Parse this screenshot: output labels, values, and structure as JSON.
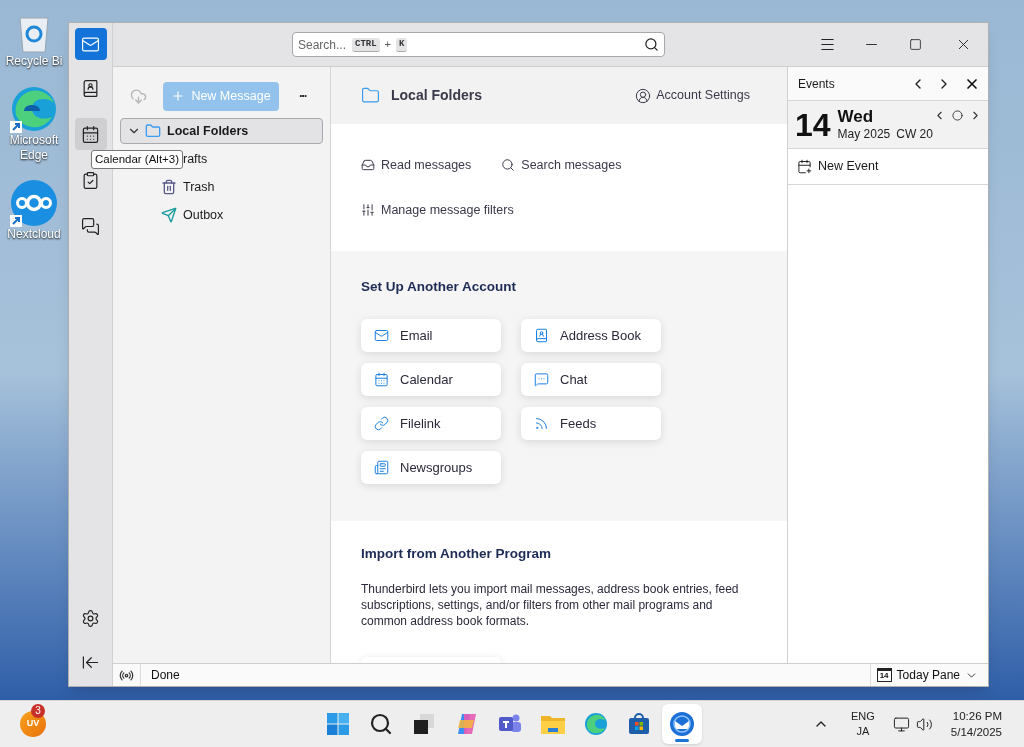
{
  "desktop_icons": [
    {
      "kind": "recycle",
      "label": "Recycle Bi"
    },
    {
      "kind": "edge",
      "label": "Microsoft Edge"
    },
    {
      "kind": "nextcloud",
      "label": "Nextcloud"
    }
  ],
  "search": {
    "placeholder": "Search...",
    "keys": [
      "CTRL",
      "K"
    ],
    "joiner": "+"
  },
  "spaces": [
    {
      "kind": "mail",
      "selected": true,
      "hovered": false
    },
    {
      "kind": "address",
      "selected": false,
      "hovered": false
    },
    {
      "kind": "calendar",
      "selected": false,
      "hovered": true
    },
    {
      "kind": "tasks",
      "selected": false,
      "hovered": false
    },
    {
      "kind": "chat",
      "selected": false,
      "hovered": false
    }
  ],
  "spaces_bottom": [
    {
      "kind": "settings"
    },
    {
      "kind": "collapse"
    }
  ],
  "tooltip": "Calendar (Alt+3)",
  "folder_pane": {
    "new_message": "New Message",
    "more": "···",
    "folders": [
      {
        "name": "Local Folders",
        "kind": "account",
        "expanded": true,
        "selected": true,
        "children": [
          {
            "name": "rafts",
            "kind": "drafts",
            "selected": false
          },
          {
            "name": "Trash",
            "kind": "trash",
            "selected": false
          },
          {
            "name": "Outbox",
            "kind": "outbox",
            "selected": false
          }
        ]
      }
    ]
  },
  "main": {
    "title": "Local Folders",
    "account_settings": "Account Settings",
    "actions": [
      {
        "kind": "read",
        "label": "Read messages"
      },
      {
        "kind": "search",
        "label": "Search messages"
      },
      {
        "kind": "filters",
        "label": "Manage message filters"
      }
    ],
    "setup": {
      "title": "Set Up Another Account",
      "cards": [
        {
          "kind": "email",
          "label": "Email"
        },
        {
          "kind": "address",
          "label": "Address Book"
        },
        {
          "kind": "calendar",
          "label": "Calendar"
        },
        {
          "kind": "chat",
          "label": "Chat"
        },
        {
          "kind": "filelink",
          "label": "Filelink"
        },
        {
          "kind": "feeds",
          "label": "Feeds"
        },
        {
          "kind": "newsgroups",
          "label": "Newsgroups"
        }
      ]
    },
    "import": {
      "title": "Import from Another Program",
      "text": "Thunderbird lets you import mail messages, address book entries, feed subscriptions, settings, and/or filters from other mail programs and common address book formats."
    }
  },
  "today_pane": {
    "title": "Events",
    "day": "14",
    "weekday": "Wed",
    "month": "May 2025",
    "week": "CW 20",
    "new_event": "New Event"
  },
  "status_bar": {
    "status": "Done",
    "today_pane": "Today Pane",
    "icon_day": "14"
  },
  "taskbar": {
    "avatar": "UV",
    "badge": "3",
    "apps": [
      {
        "kind": "start",
        "selected": false
      },
      {
        "kind": "search",
        "selected": false
      },
      {
        "kind": "taskview",
        "selected": false
      },
      {
        "kind": "copilot",
        "selected": false
      },
      {
        "kind": "teams",
        "selected": false
      },
      {
        "kind": "explorer",
        "selected": false
      },
      {
        "kind": "edge",
        "selected": false
      },
      {
        "kind": "store",
        "selected": false
      },
      {
        "kind": "thunderbird",
        "selected": true
      }
    ],
    "language": [
      "ENG",
      "JA"
    ],
    "time": "10:26 PM",
    "date": "5/14/2025"
  }
}
